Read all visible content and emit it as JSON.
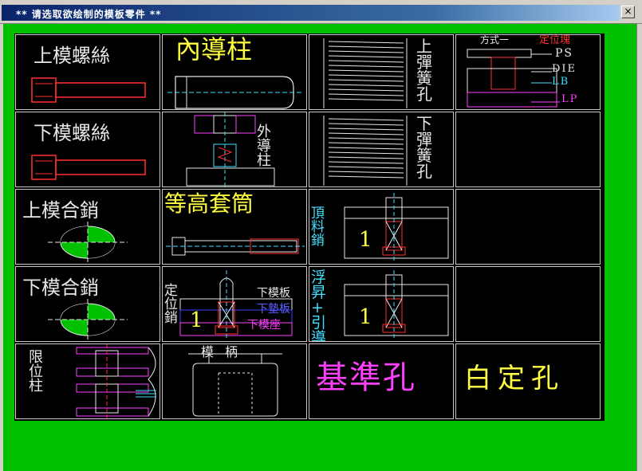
{
  "window": {
    "title": "** 请选取欲绘制的模板零件 **",
    "close_label": "×"
  },
  "cells": {
    "r1c1": {
      "label": "上模螺絲"
    },
    "r1c2": {
      "label": "內導柱"
    },
    "r1c3": {
      "label": "上彈簧孔"
    },
    "r1c4": {
      "label_way": "方式一",
      "label_locate": "定位塊",
      "label_ps": "PS",
      "label_die": "DIE",
      "label_lb": "LB",
      "label_lp": "LP"
    },
    "r2c1": {
      "label": "下模螺絲"
    },
    "r2c2": {
      "label": "外導柱"
    },
    "r2c3": {
      "label": "下彈簧孔"
    },
    "r3c1": {
      "label": "上模合銷"
    },
    "r3c2": {
      "label": "等高套筒"
    },
    "r3c3": {
      "label": "頂料銷",
      "num": "1"
    },
    "r4c1": {
      "label": "下模合銷"
    },
    "r4c2": {
      "label": "定位銷",
      "num": "1",
      "plate1": "下模板",
      "plate2": "下墊板",
      "plate3": "下模座"
    },
    "r4c3": {
      "label": "浮昇+引導",
      "num": "1"
    },
    "r5c1": {
      "label": "限位柱"
    },
    "r5c2": {
      "label": "模柄"
    },
    "r5c3": {
      "label": "基準孔"
    },
    "r5c4": {
      "label": "白定孔"
    }
  },
  "colors": {
    "background": "#00c000",
    "cell": "#000000",
    "yellow": "#ffff40",
    "white": "#e8e8e8",
    "cyan": "#40e0ff",
    "magenta": "#ff40ff",
    "red": "#ff3030"
  }
}
